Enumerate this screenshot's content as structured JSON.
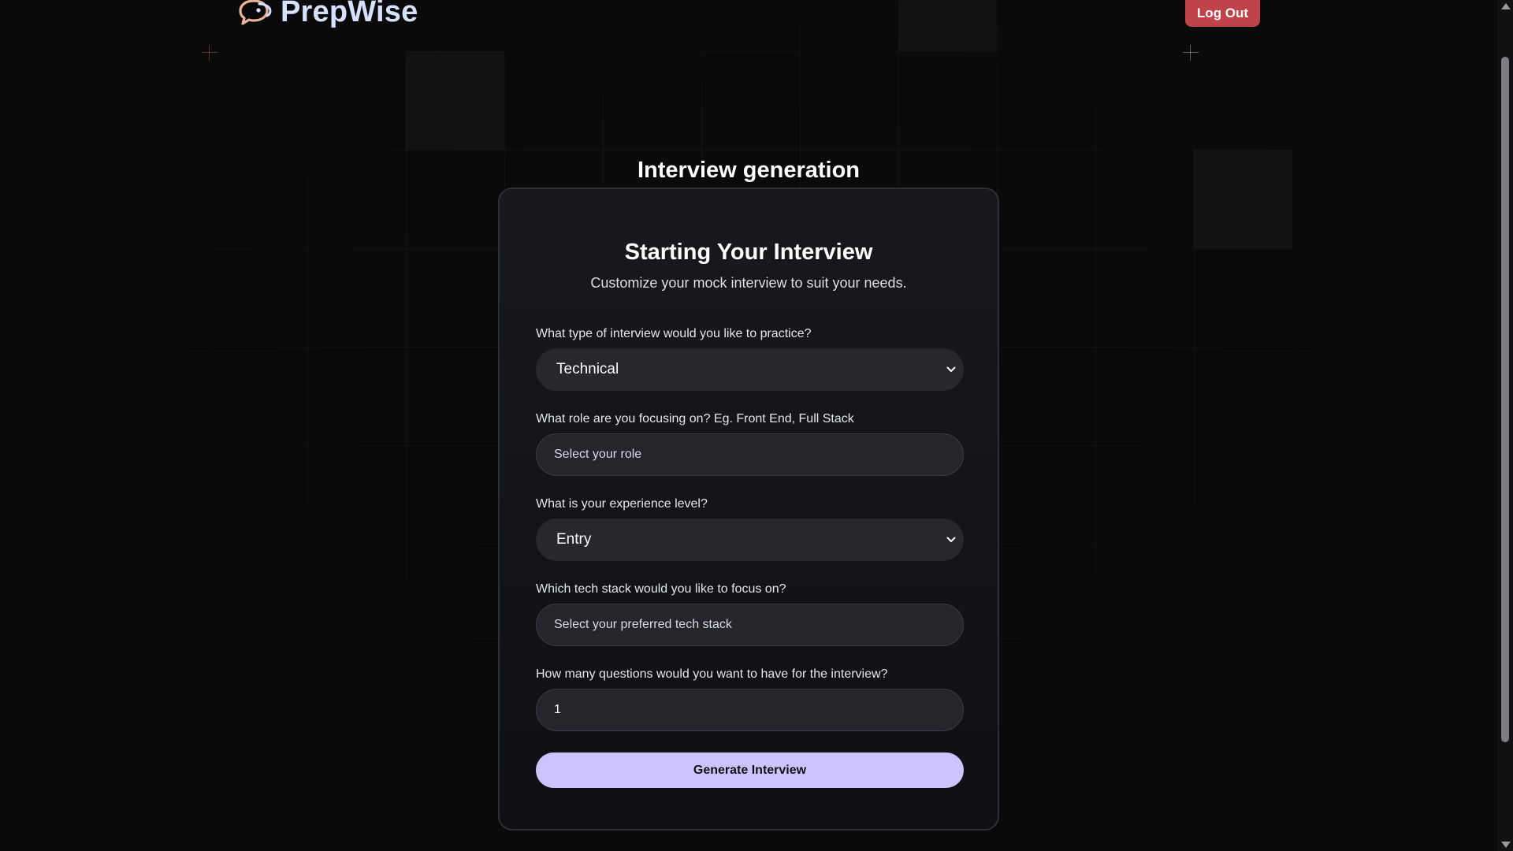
{
  "header": {
    "brand_name": "PrepWise",
    "brand_icon": "chat-bubbles-icon",
    "logout_label": "Log Out"
  },
  "page": {
    "title": "Interview generation"
  },
  "form": {
    "title": "Starting Your Interview",
    "subtitle": "Customize your mock interview to suit your needs.",
    "fields": [
      {
        "label": "What type of interview would you like to practice?",
        "type": "select",
        "value": "Technical"
      },
      {
        "label": "What role are you focusing on? Eg. Front End, Full Stack",
        "type": "text",
        "value": "",
        "placeholder": "Select your role"
      },
      {
        "label": "What is your experience level?",
        "type": "select",
        "value": "Entry"
      },
      {
        "label": "Which tech stack would you like to focus on?",
        "type": "text",
        "value": "",
        "placeholder": "Select your preferred tech stack"
      },
      {
        "label": "How many questions would you want to have for the interview?",
        "type": "number",
        "value": "1"
      }
    ],
    "submit_label": "Generate Interview"
  },
  "colors": {
    "accent": "#cbc4ff",
    "logout": "#c0434a",
    "brand": "#d6e0ff"
  }
}
